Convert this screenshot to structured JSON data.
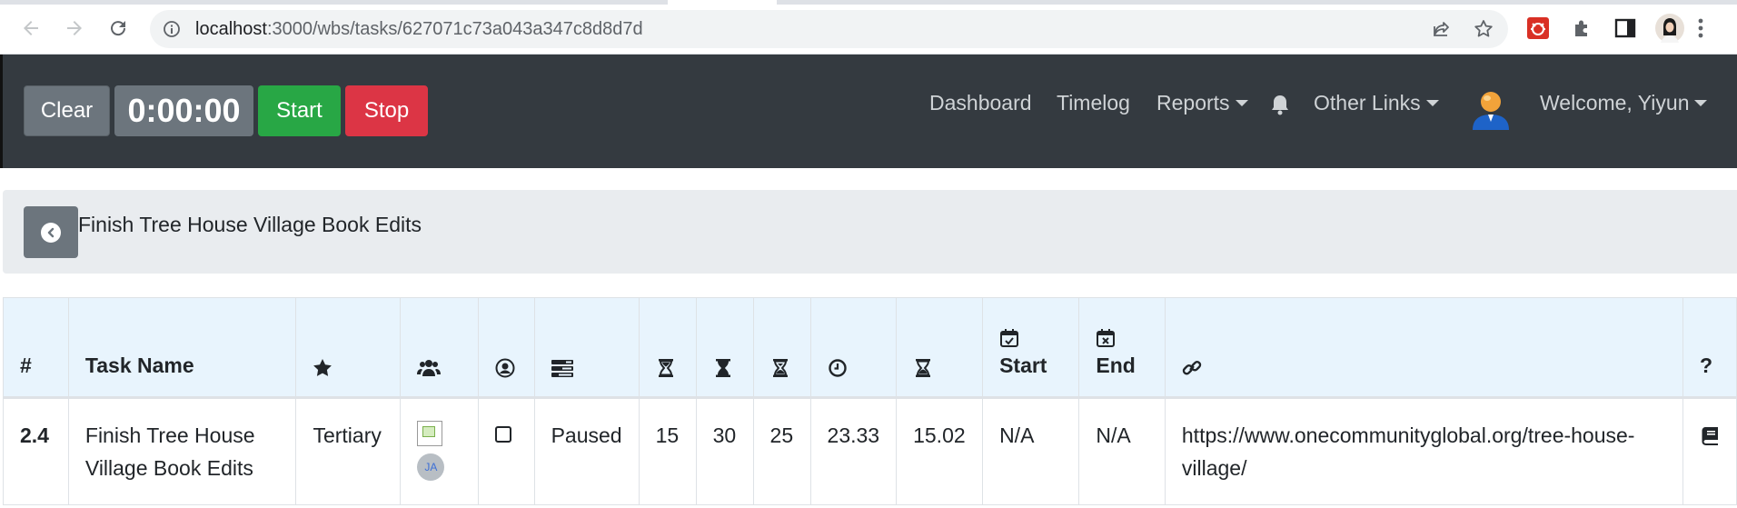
{
  "browser": {
    "url_host": "localhost",
    "url_path": ":3000/wbs/tasks/627071c73a043a347c8d8d7d"
  },
  "toolbar": {
    "clear_label": "Clear",
    "timer_value": "0:00:00",
    "start_label": "Start",
    "stop_label": "Stop"
  },
  "nav": {
    "dashboard": "Dashboard",
    "timelog": "Timelog",
    "reports": "Reports",
    "other_links": "Other Links",
    "welcome": "Welcome, Yiyun"
  },
  "task": {
    "title": "Finish Tree House Village Book Edits"
  },
  "table": {
    "headers": {
      "num": "#",
      "task_name": "Task Name",
      "start": "Start",
      "end": "End",
      "help": "?"
    },
    "row": {
      "num": "2.4",
      "name": "Finish Tree House Village Book Edits",
      "priority": "Tertiary",
      "member_initials": "JA",
      "status": "Paused",
      "hours_best": "15",
      "hours_worst": "30",
      "hours_most": "25",
      "hours_estimated": "23.33",
      "hours_logged": "15.02",
      "start": "N/A",
      "end": "N/A",
      "link": "https://www.onecommunityglobal.org/tree-house-village/"
    }
  },
  "colors": {
    "navbar": "#343a40",
    "start": "#28a745",
    "stop": "#dc3545",
    "secondary": "#6c757d",
    "table_header": "#e8f4fd"
  }
}
